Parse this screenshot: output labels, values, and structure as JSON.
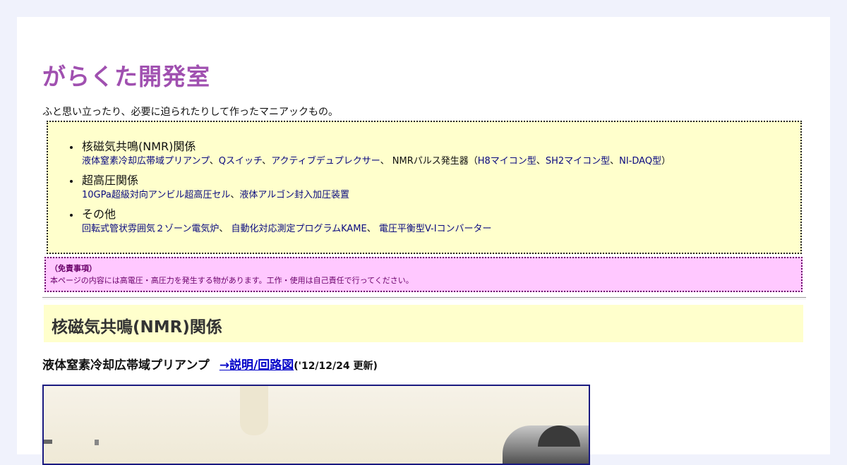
{
  "site": {
    "title": "がらくた開発室",
    "tagline": "ふと思い立ったり、必要に迫られたりして作ったマニアックもの。"
  },
  "toc": {
    "nmr": {
      "label": "核磁気共鳴(NMR)関係",
      "link_a": "液体窒素冷却広帯域プリアンプ",
      "sep1": "、",
      "link_b": "Qスイッチ",
      "sep2": "、",
      "link_c": "アクティブデュプレクサー",
      "sep3": "、 NMRパルス発生器（",
      "link_d": "H8マイコン型",
      "sep4": "、",
      "link_e": "SH2マイコン型",
      "sep5": "、",
      "link_f": "NI-DAQ型",
      "sep6": "）"
    },
    "highpressure": {
      "label": "超高圧関係",
      "link_a": "10GPa超級対向アンビル超高圧セル",
      "sep1": "、",
      "link_b": "液体アルゴン封入加圧装置"
    },
    "other": {
      "label": "その他",
      "link_a": "回転式管状雰囲気２ゾーン電気炉",
      "sep1": "、 ",
      "link_b": "自動化対応測定プログラムKAME",
      "sep2": "、 ",
      "link_c": "電圧平衡型V-Iコンバーター"
    }
  },
  "disclaimer": {
    "title": "（免責事項）",
    "text": "本ページの内容には高電圧・高圧力を発生する物があります。工作・使用は自己責任で行ってください。"
  },
  "section": {
    "heading": "核磁気共鳴(NMR)関係"
  },
  "item": {
    "title": "液体窒素冷却広帯域プリアンプ",
    "link": "→説明/回路図",
    "date": "('12/12/24 更新)"
  },
  "colors": {
    "page_bg": "#f0f2fc",
    "title": "#a050b0",
    "toc_bg": "#ffffcc",
    "disclaimer_bg": "#ffc8ff",
    "link": "#0000c8"
  }
}
